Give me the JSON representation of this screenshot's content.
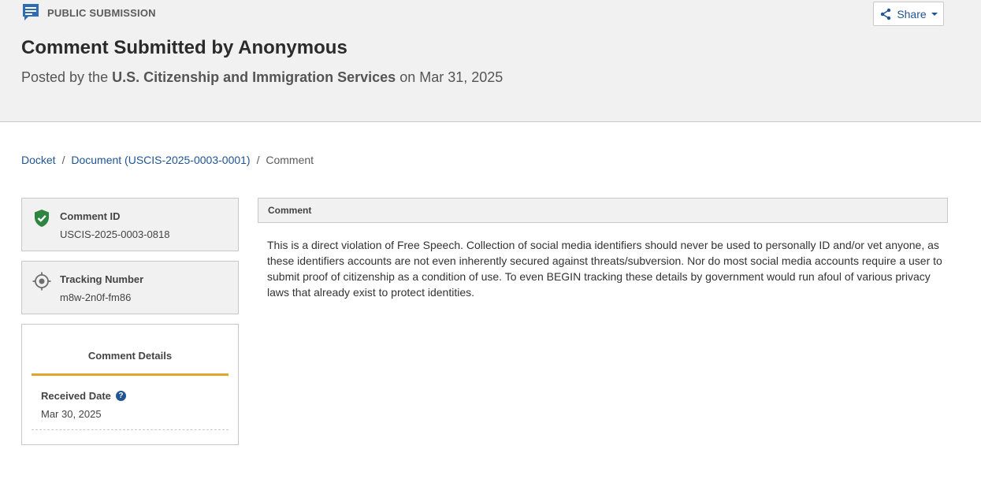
{
  "header": {
    "submission_type": "PUBLIC SUBMISSION",
    "share_label": "Share",
    "title": "Comment Submitted by Anonymous",
    "posted_prefix": "Posted by the",
    "agency": "U.S. Citizenship and Immigration Services",
    "posted_suffix": "on Mar 31, 2025"
  },
  "breadcrumb": {
    "docket": "Docket",
    "sep1": "/",
    "document": "Document (USCIS-2025-0003-0001)",
    "sep2": "/",
    "current": "Comment"
  },
  "sidebar": {
    "comment_id_label": "Comment ID",
    "comment_id_value": "USCIS-2025-0003-0818",
    "tracking_label": "Tracking Number",
    "tracking_value": "m8w-2n0f-fm86",
    "details_title": "Comment Details",
    "received_label": "Received Date",
    "received_value": "Mar 30, 2025"
  },
  "comment": {
    "heading": "Comment",
    "body": "This is a direct violation of Free Speech. Collection of social media identifiers should never be used to personally ID and/or vet anyone, as these identifiers accounts are not even inherently secured against threats/subversion. Nor do most social media accounts require a user to submit proof of citizenship as a condition of use. To even BEGIN tracking these details by government would run afoul of various privacy laws that already exist to protect identities."
  },
  "colors": {
    "link": "#205493",
    "accent": "#e1a72a",
    "verified": "#2e8540",
    "header_bg": "#f1f1f1"
  },
  "icons": {
    "submission": "comment-icon",
    "share": "share-icon",
    "comment_id": "verified-shield-icon",
    "tracking": "crosshair-icon",
    "help": "question-circle-icon"
  }
}
